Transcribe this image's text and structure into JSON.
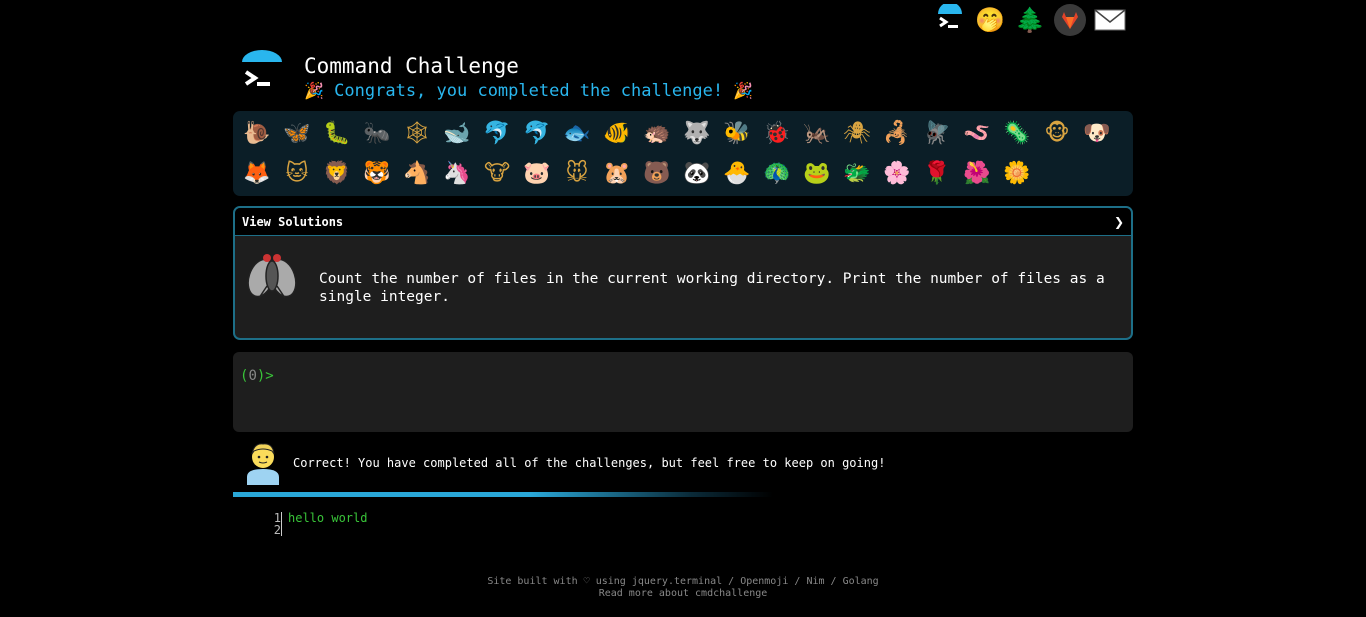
{
  "topnav": {
    "items": [
      {
        "name": "terminal-logo-icon",
        "glyph": ">_"
      },
      {
        "name": "face-with-hand-over-mouth-icon",
        "glyph": "🤭"
      },
      {
        "name": "evergreen-tree-icon",
        "glyph": "🌲"
      },
      {
        "name": "gitlab-icon",
        "glyph": "🦊"
      },
      {
        "name": "envelope-icon",
        "glyph": "✉"
      }
    ]
  },
  "header": {
    "title": "Command Challenge",
    "subtitle": "Congrats, you completed the challenge!",
    "party_emoji": "🎉"
  },
  "challenges": [
    "🐌",
    "🦋",
    "🐛",
    "🐜",
    "🕸",
    "🐋",
    "🐬",
    "🐬",
    "🐟",
    "🐠",
    "🦔",
    "🐺",
    "🐝",
    "🐞",
    "🦗",
    "🕷",
    "🦂",
    "🪰",
    "🪱",
    "🦠",
    "🐵",
    "🐶",
    "🦊",
    "🐱",
    "🦁",
    "🐯",
    "🐴",
    "🦄",
    "🐮",
    "🐷",
    "🐭",
    "🐹",
    "🐻",
    "🐼",
    "🐣",
    "🦚",
    "🐸",
    "🐲",
    "🌸",
    "🌹",
    "🌺",
    "🌼"
  ],
  "solutions": {
    "header_label": "View Solutions",
    "chevron": "❯",
    "task_text": "Count the number of files in the current working directory. Print the number of files as a single integer."
  },
  "terminal": {
    "prompt_open": "(",
    "prompt_count": "0",
    "prompt_close": ")>"
  },
  "result": {
    "message": "Correct! You have completed all of the challenges, but feel free to keep on going!"
  },
  "progress": {
    "value": 1.0
  },
  "editor": {
    "line_numbers": [
      "1",
      "2"
    ],
    "lines": [
      "hello world",
      ""
    ]
  },
  "footer": {
    "prefix": "Site built with ",
    "heart": "♡",
    "using": " using ",
    "link_jquery": "jquery.terminal",
    "sep1": " / ",
    "link_openmoji": "Openmoji",
    "sep2": " / ",
    "link_nim": "Nim",
    "sep3": " / ",
    "link_golang": "Golang",
    "read_more": "Read more about cmdchallenge"
  },
  "colors": {
    "background": "#000000",
    "accent": "#29b6ee",
    "prompt_green": "#39c439",
    "panel": "#1e1e1e",
    "grid_bg": "#0b1e27",
    "border": "#1d6f88"
  }
}
